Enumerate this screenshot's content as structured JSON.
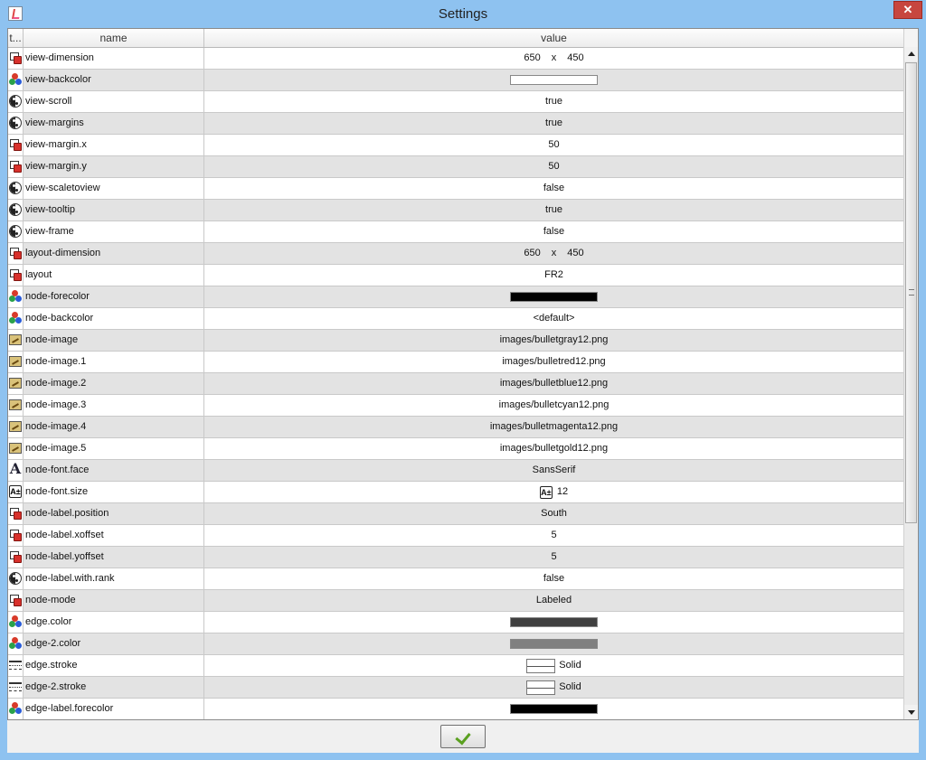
{
  "window": {
    "title": "Settings"
  },
  "columns": {
    "type": "t...",
    "name": "name",
    "value": "value"
  },
  "rows": [
    {
      "icon": "property-icon",
      "name": "view-dimension",
      "kind": "dim",
      "w": "650",
      "x": "x",
      "h": "450"
    },
    {
      "icon": "color-icon",
      "name": "view-backcolor",
      "kind": "color",
      "color": "#ffffff"
    },
    {
      "icon": "boolean-icon",
      "name": "view-scroll",
      "kind": "text",
      "value": "true"
    },
    {
      "icon": "boolean-icon",
      "name": "view-margins",
      "kind": "text",
      "value": "true"
    },
    {
      "icon": "property-icon",
      "name": "view-margin.x",
      "kind": "text",
      "value": "50"
    },
    {
      "icon": "property-icon",
      "name": "view-margin.y",
      "kind": "text",
      "value": "50"
    },
    {
      "icon": "boolean-icon",
      "name": "view-scaletoview",
      "kind": "text",
      "value": "false"
    },
    {
      "icon": "boolean-icon",
      "name": "view-tooltip",
      "kind": "text",
      "value": "true"
    },
    {
      "icon": "boolean-icon",
      "name": "view-frame",
      "kind": "text",
      "value": "false"
    },
    {
      "icon": "property-icon",
      "name": "layout-dimension",
      "kind": "dim",
      "w": "650",
      "x": "x",
      "h": "450"
    },
    {
      "icon": "property-icon",
      "name": "layout",
      "kind": "text",
      "value": "FR2"
    },
    {
      "icon": "color-icon",
      "name": "node-forecolor",
      "kind": "color",
      "color": "#000000"
    },
    {
      "icon": "color-icon",
      "name": "node-backcolor",
      "kind": "text",
      "value": "<default>"
    },
    {
      "icon": "image-icon",
      "name": "node-image",
      "kind": "text",
      "value": "images/bulletgray12.png"
    },
    {
      "icon": "image-icon",
      "name": "node-image.1",
      "kind": "text",
      "value": "images/bulletred12.png"
    },
    {
      "icon": "image-icon",
      "name": "node-image.2",
      "kind": "text",
      "value": "images/bulletblue12.png"
    },
    {
      "icon": "image-icon",
      "name": "node-image.3",
      "kind": "text",
      "value": "images/bulletcyan12.png"
    },
    {
      "icon": "image-icon",
      "name": "node-image.4",
      "kind": "text",
      "value": "images/bulletmagenta12.png"
    },
    {
      "icon": "image-icon",
      "name": "node-image.5",
      "kind": "text",
      "value": "images/bulletgold12.png"
    },
    {
      "icon": "font-face-icon",
      "name": "node-font.face",
      "kind": "text",
      "value": "SansSerif"
    },
    {
      "icon": "font-size-icon",
      "name": "node-font.size",
      "kind": "fontsize",
      "value": "12"
    },
    {
      "icon": "property-icon",
      "name": "node-label.position",
      "kind": "text",
      "value": "South"
    },
    {
      "icon": "property-icon",
      "name": "node-label.xoffset",
      "kind": "text",
      "value": "5"
    },
    {
      "icon": "property-icon",
      "name": "node-label.yoffset",
      "kind": "text",
      "value": "5"
    },
    {
      "icon": "boolean-icon",
      "name": "node-label.with.rank",
      "kind": "text",
      "value": "false"
    },
    {
      "icon": "property-icon",
      "name": "node-mode",
      "kind": "text",
      "value": "Labeled"
    },
    {
      "icon": "color-icon",
      "name": "edge.color",
      "kind": "color",
      "color": "#404040"
    },
    {
      "icon": "color-icon",
      "name": "edge-2.color",
      "kind": "color",
      "color": "#808080"
    },
    {
      "icon": "stroke-icon",
      "name": "edge.stroke",
      "kind": "stroke",
      "value": "Solid"
    },
    {
      "icon": "stroke-icon",
      "name": "edge-2.stroke",
      "kind": "stroke",
      "value": "Solid"
    },
    {
      "icon": "color-icon",
      "name": "edge-label.forecolor",
      "kind": "color",
      "color": "#000000"
    }
  ],
  "font_size_glyph": "A±",
  "font_face_glyph": "A",
  "colors": {
    "titlebar": "#8ec2f0",
    "row_alt": "#e3e3e3",
    "close": "#c7463f",
    "check": "#5aa020"
  }
}
